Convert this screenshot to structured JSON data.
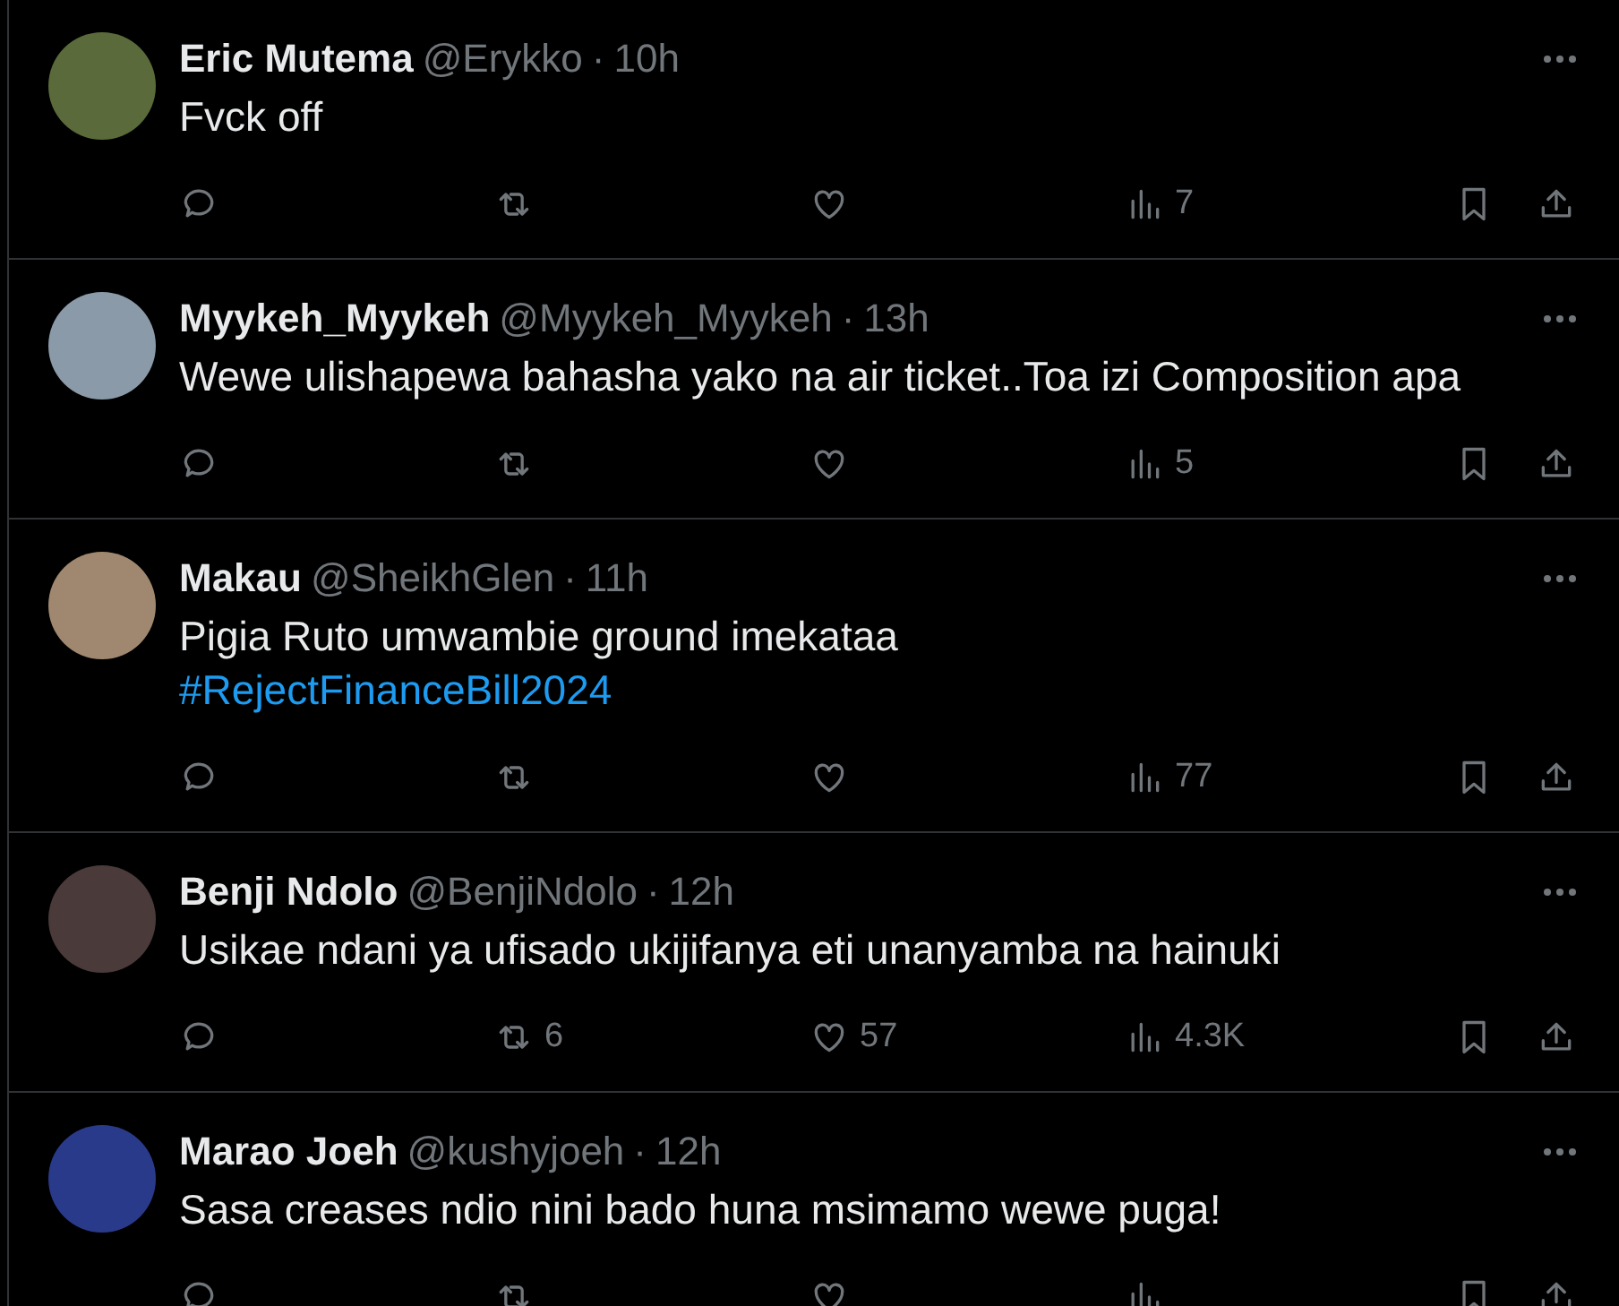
{
  "tweets": [
    {
      "name": "Eric Mutema",
      "handle": "@Erykko",
      "sep": "·",
      "time": "10h",
      "text": "Fvck off",
      "views": "7"
    },
    {
      "name": "Myykeh_Myykeh",
      "handle": "@Myykeh_Myykeh",
      "sep": "·",
      "time": "13h",
      "text": "Wewe ulishapewa bahasha yako na air ticket..Toa izi Composition apa",
      "views": "5"
    },
    {
      "name": "Makau",
      "handle": "@SheikhGlen",
      "sep": "·",
      "time": "11h",
      "text": "Pigia Ruto umwambie ground imekataa",
      "hashtag": "#RejectFinanceBill2024",
      "views": "77"
    },
    {
      "name": "Benji Ndolo",
      "handle": "@BenjiNdolo",
      "sep": "·",
      "time": "12h",
      "text": "Usikae ndani ya ufisado ukijifanya eti unanyamba na hainuki",
      "retweets": "6",
      "likes": "57",
      "views": "4.3K"
    },
    {
      "name": "Marao Joeh",
      "handle": "@kushyjoeh",
      "sep": "·",
      "time": "12h",
      "text": "Sasa creases ndio nini bado huna msimamo wewe puga!"
    }
  ]
}
